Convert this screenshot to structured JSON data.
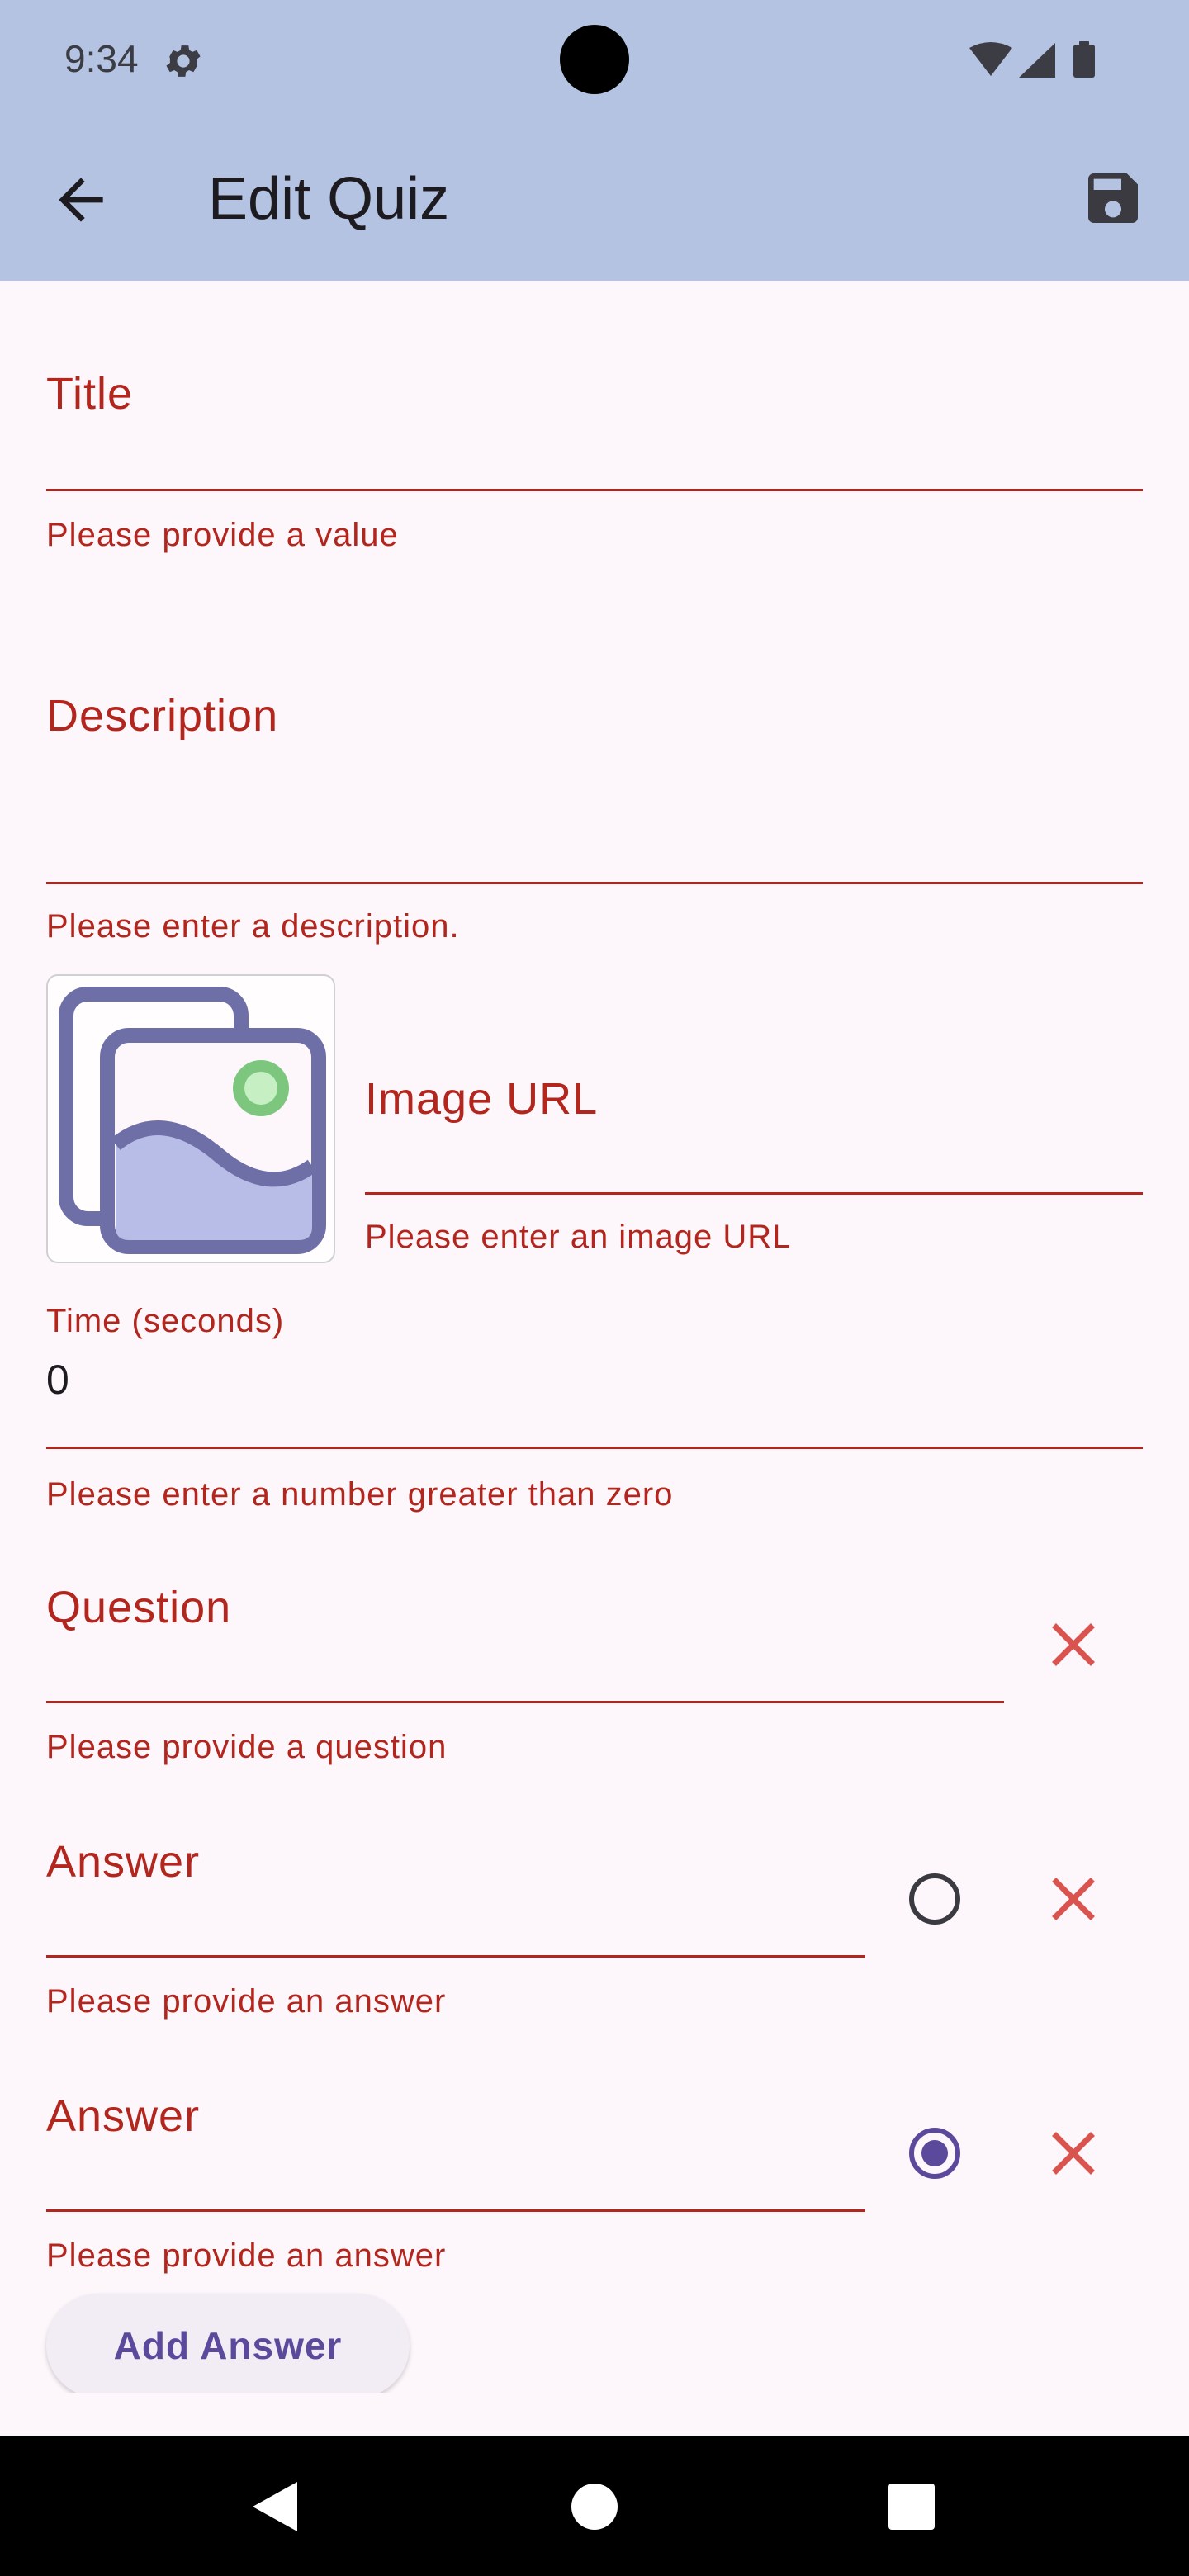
{
  "status_bar": {
    "time": "9:34",
    "icons": [
      "gear-icon",
      "wifi-icon",
      "cellular-icon",
      "battery-icon"
    ]
  },
  "app_bar": {
    "title": "Edit Quiz",
    "back_icon": "arrow-back-icon",
    "save_icon": "save-icon"
  },
  "form": {
    "title": {
      "label": "Title",
      "value": "",
      "error": "Please provide a value"
    },
    "description": {
      "label": "Description",
      "value": "",
      "error": "Please enter a description."
    },
    "image_url": {
      "label": "Image URL",
      "value": "",
      "error": "Please enter an image URL"
    },
    "time": {
      "label": "Time (seconds)",
      "value": "0",
      "error": "Please enter a number greater than zero"
    },
    "question": {
      "label": "Question",
      "value": "",
      "error": "Please provide a question"
    },
    "answers": [
      {
        "label": "Answer",
        "value": "",
        "error": "Please provide an answer",
        "correct": false
      },
      {
        "label": "Answer",
        "value": "",
        "error": "Please provide an answer",
        "correct": true
      }
    ],
    "add_answer_label": "Add Answer"
  },
  "colors": {
    "error": "#b3261e",
    "app_bar": "#b3c3e1",
    "accent": "#5b4a9c",
    "delete": "#d9534f"
  }
}
